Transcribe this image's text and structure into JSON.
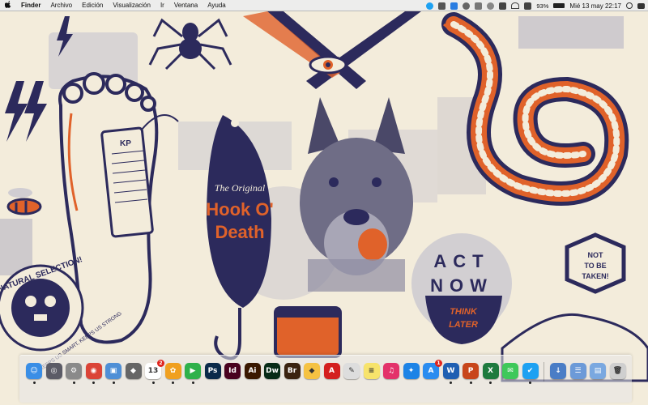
{
  "menubar": {
    "apple": "",
    "app": "Finder",
    "items": [
      "Archivo",
      "Edición",
      "Visualización",
      "Ir",
      "Ventana",
      "Ayuda"
    ],
    "battery": "93%",
    "clock": "Mié 13 may  22:17"
  },
  "wallpaper": {
    "tag_text": "KP",
    "lure_line1": "The Original",
    "lure_line2": "Hook O'",
    "lure_line3": "Death",
    "badge_left": "NATURAL SELECTION!",
    "badge_left_sub": "KEEPS US SMART, KEEPS US STRONG",
    "act_now_1": "ACT",
    "act_now_2": "NOW",
    "think_1": "THINK",
    "think_2": "LATER",
    "hex_1": "NOT",
    "hex_2": "TO BE",
    "hex_3": "TAKEN!",
    "colors": {
      "navy": "#2c2a5c",
      "orange": "#e0622a",
      "cream": "#f3ecdb",
      "gray": "#a8a6b6"
    }
  },
  "dock": {
    "items": [
      {
        "name": "Finder",
        "glyph": "☺",
        "color": "#3a8ee6"
      },
      {
        "name": "Launchpad",
        "glyph": "◎",
        "color": "#5b5b66"
      },
      {
        "name": "System Preferences",
        "glyph": "⚙",
        "color": "#8a8a8a"
      },
      {
        "name": "Chrome",
        "glyph": "◉",
        "color": "#db4437"
      },
      {
        "name": "Preview",
        "glyph": "▣",
        "color": "#4f8fd6"
      },
      {
        "name": "Image Capture",
        "glyph": "◆",
        "color": "#666"
      },
      {
        "name": "Calendar",
        "glyph": "13",
        "color": "#ffffff",
        "badge": "2"
      },
      {
        "name": "Photos",
        "glyph": "✿",
        "color": "#f0a020"
      },
      {
        "name": "FaceTime",
        "glyph": "▶",
        "color": "#2fb14b"
      },
      {
        "name": "Photoshop",
        "glyph": "Ps",
        "color": "#0b2a4a"
      },
      {
        "name": "InDesign",
        "glyph": "Id",
        "color": "#49021f"
      },
      {
        "name": "Illustrator",
        "glyph": "Ai",
        "color": "#3a1800"
      },
      {
        "name": "Dreamweaver",
        "glyph": "Dw",
        "color": "#072b17"
      },
      {
        "name": "Bridge",
        "glyph": "Br",
        "color": "#3a2310"
      },
      {
        "name": "Sketch",
        "glyph": "◆",
        "color": "#f5c242"
      },
      {
        "name": "Acrobat",
        "glyph": "A",
        "color": "#d41f1f"
      },
      {
        "name": "TextEdit",
        "glyph": "✎",
        "color": "#ddd"
      },
      {
        "name": "Notes",
        "glyph": "≡",
        "color": "#f7e36b"
      },
      {
        "name": "iTunes",
        "glyph": "♫",
        "color": "#e3326a"
      },
      {
        "name": "Safari",
        "glyph": "✦",
        "color": "#1d83e6"
      },
      {
        "name": "App Store",
        "glyph": "A",
        "color": "#2a8cf0",
        "badge": "1"
      },
      {
        "name": "Word",
        "glyph": "W",
        "color": "#1f5fb2"
      },
      {
        "name": "PowerPoint",
        "glyph": "P",
        "color": "#c8461b"
      },
      {
        "name": "Excel",
        "glyph": "X",
        "color": "#1e7a3e"
      },
      {
        "name": "Messages",
        "glyph": "✉",
        "color": "#3ec85a"
      },
      {
        "name": "Twitter",
        "glyph": "✔",
        "color": "#1da1f2"
      },
      {
        "name": "Downloads",
        "glyph": "↓",
        "color": "#4a7dc6"
      },
      {
        "name": "Documents",
        "glyph": "☰",
        "color": "#6c9ad8"
      },
      {
        "name": "Folder",
        "glyph": "▤",
        "color": "#7aa8e0"
      },
      {
        "name": "Trash",
        "glyph": "🗑",
        "color": "#cfcfcf"
      }
    ]
  }
}
